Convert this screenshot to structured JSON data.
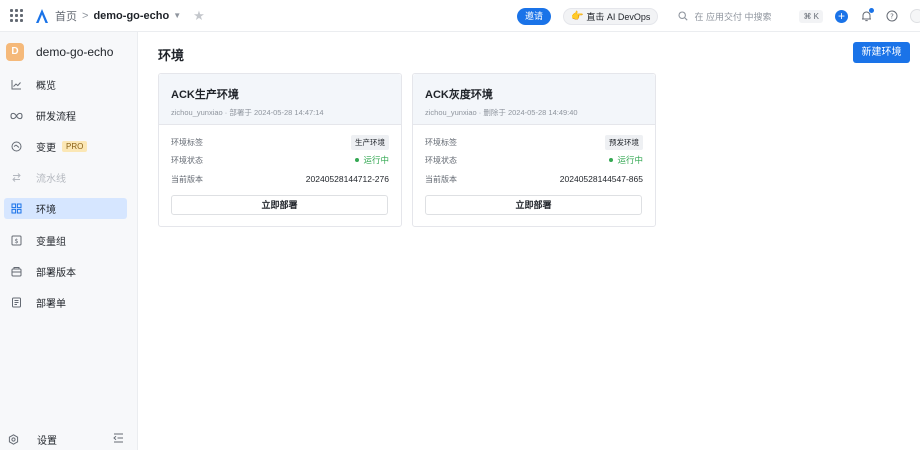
{
  "header": {
    "breadcrumb_home": "首页",
    "breadcrumb_sep": ">",
    "app_name": "demo-go-echo",
    "invite_label": "邀请",
    "ai_label": "直击 AI DevOps",
    "search_placeholder": "在 应用交付 中搜索",
    "shortcut": "⌘ K",
    "accent": "#1a73e8"
  },
  "sidebar": {
    "app_initial": "D",
    "app_name": "demo-go-echo",
    "items": [
      {
        "label": "概览",
        "icon": "chart-line-icon"
      },
      {
        "label": "研发流程",
        "icon": "infinity-icon"
      },
      {
        "label": "变更",
        "icon": "change-icon",
        "badge": "PRO"
      },
      {
        "label": "流水线",
        "icon": "pipeline-icon",
        "disabled": true
      },
      {
        "label": "环境",
        "icon": "environment-icon",
        "active": true
      },
      {
        "label": "变量组",
        "icon": "variable-group-icon"
      },
      {
        "label": "部署版本",
        "icon": "deploy-version-icon"
      },
      {
        "label": "部署单",
        "icon": "deploy-order-icon"
      }
    ],
    "settings_label": "设置"
  },
  "main": {
    "title": "环境",
    "new_button": "新建环境",
    "cards": [
      {
        "title": "ACK生产环境",
        "meta": "zichou_yunxiao · 部署于 2024-05-28 14:47:14",
        "tag_label": "环境标签",
        "tag": "生产环境",
        "status_label": "环境状态",
        "status": "运行中",
        "version_label": "当前版本",
        "version": "20240528144712-276",
        "deploy_button": "立即部署"
      },
      {
        "title": "ACK灰度环境",
        "meta": "zichou_yunxiao · 删除于 2024-05-28 14:49:40",
        "tag_label": "环境标签",
        "tag": "预发环境",
        "status_label": "环境状态",
        "status": "运行中",
        "version_label": "当前版本",
        "version": "20240528144547-865",
        "deploy_button": "立即部署"
      }
    ]
  }
}
